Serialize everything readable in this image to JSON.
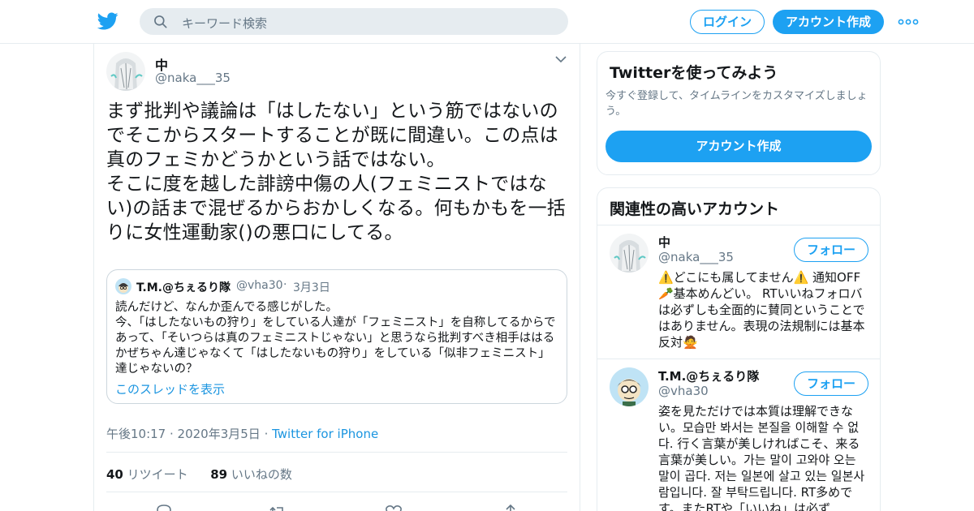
{
  "header": {
    "search_placeholder": "キーワード検索",
    "login_label": "ログイン",
    "signup_label": "アカウント作成",
    "brand_color": "#1da1f2"
  },
  "tweet": {
    "name": "中",
    "handle": "@naka___35",
    "text": "まず批判や議論は「はしたない」という筋ではないのでそこからスタートすることが既に間違い。この点は真のフェミかどうかという話ではない。\nそこに度を越した誹謗中傷の人(フェミニストではない)の話まで混ぜるからおかしくなる。何もかもを一括りに女性運動家()の悪口にしてる。",
    "time": "午後10:17 · 2020年3月5日",
    "meta_sep": " · ",
    "source": "Twitter for iPhone",
    "retweets_count": "40",
    "retweets_label": "リツイート",
    "likes_count": "89",
    "likes_label": "いいねの数"
  },
  "quote": {
    "name": "T.M.@ちぇるり隊",
    "handle": "@vha30",
    "dot": "·",
    "date": "3月3日",
    "text": "読んだけど、なんか歪んでる感じがした。\n今、「はしたないもの狩り」をしている人達が「フェミニスト」を自称してるからであって、「そいつらは真のフェミニストじゃない」と思うなら批判すべき相手ははるかぜちゃん達じゃなくて「はしたないもの狩り」をしている「似非フェミニスト」達じゃないの？",
    "thread_link": "このスレッドを表示"
  },
  "sidebar": {
    "signup_card": {
      "title": "Twitterを使ってみよう",
      "description": "今すぐ登録して、タイムラインをカスタマイズしましょう。",
      "button_label": "アカウント作成"
    },
    "related": {
      "title": "関連性の高いアカウント",
      "follow_label": "フォロー",
      "accounts": [
        {
          "name": "中",
          "handle": "@naka___35",
          "bio": "⚠️どこにも属してません⚠️ 通知OFF🥕基本めんどい。 RTいいねフォロバは必ずしも全面的に賛同ということではありません。表現の法規制には基本反対🙅"
        },
        {
          "name": "T.M.@ちぇるり隊",
          "handle": "@vha30",
          "bio": "姿を見ただけでは本質は理解できない。모습만 봐서는 본질을 이해할 수 없다. 行く言葉が美しければこそ、来る言葉が美しい。가는 말이 고와야 오는 말이 곱다. 저는 일본에 살고 있는 일본사람입니다. 잘 부탁드립니다. RT多めです。またRTや「いいね」は必ず"
        }
      ]
    }
  }
}
